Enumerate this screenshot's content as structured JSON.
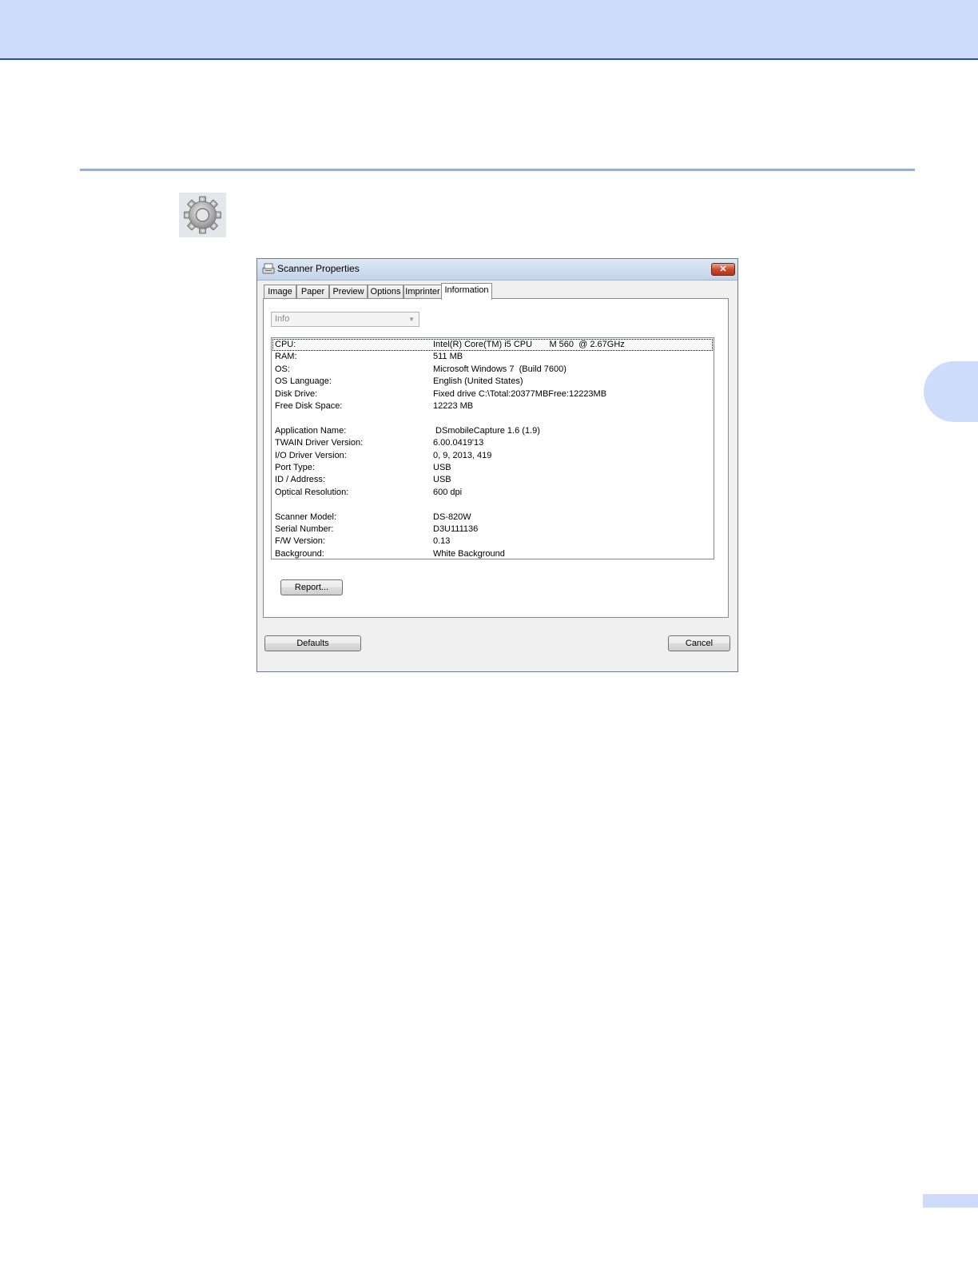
{
  "dialog": {
    "title": "Scanner Properties",
    "close_label": "✕",
    "tabs": [
      "Image",
      "Paper",
      "Preview",
      "Options",
      "Imprinter",
      "Information"
    ],
    "active_tab": "Information",
    "select": {
      "value": "Info"
    },
    "info_rows": [
      {
        "key": "CPU:",
        "value": "Intel(R) Core(TM) i5 CPU       M 560  @ 2.67GHz"
      },
      {
        "key": "RAM:",
        "value": "511 MB"
      },
      {
        "key": "OS:",
        "value": "Microsoft Windows 7  (Build 7600)"
      },
      {
        "key": "OS Language:",
        "value": "English (United States)"
      },
      {
        "key": "Disk Drive:",
        "value": "Fixed drive C:\\Total:20377MBFree:12223MB"
      },
      {
        "key": "Free Disk Space:",
        "value": "12223 MB"
      },
      {
        "key": "",
        "value": ""
      },
      {
        "key": "Application Name:",
        "value": " DSmobileCapture 1.6 (1.9)"
      },
      {
        "key": "TWAIN Driver Version:",
        "value": "6.00.0419'13"
      },
      {
        "key": "I/O Driver Version:",
        "value": "0, 9, 2013, 419"
      },
      {
        "key": "Port Type:",
        "value": "USB"
      },
      {
        "key": "ID / Address:",
        "value": "USB"
      },
      {
        "key": "Optical Resolution:",
        "value": "600 dpi"
      },
      {
        "key": "",
        "value": ""
      },
      {
        "key": "Scanner Model:",
        "value": "DS-820W"
      },
      {
        "key": "Serial Number:",
        "value": "D3U111136"
      },
      {
        "key": "F/W Version:",
        "value": "0.13"
      },
      {
        "key": "Background:",
        "value": "White Background"
      }
    ],
    "report_label": "Report...",
    "defaults_label": "Defaults",
    "cancel_label": "Cancel"
  },
  "colors": {
    "header_band": "#cddcfb",
    "header_rule": "#2b4ea8",
    "section_rule": "#8fb0ef"
  }
}
